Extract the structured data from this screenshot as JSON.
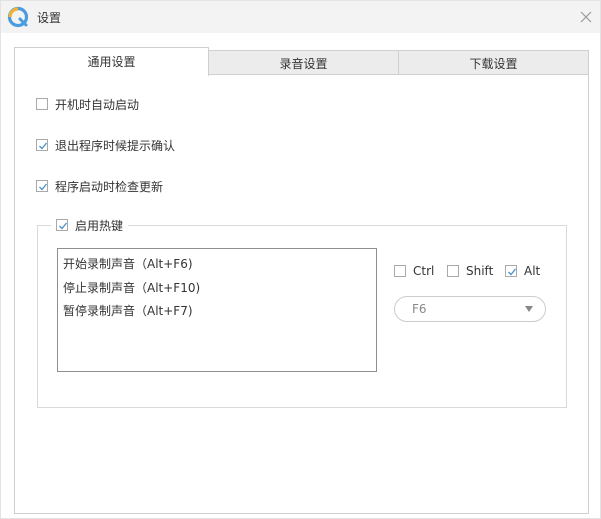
{
  "window": {
    "title": "设置"
  },
  "tabs": [
    {
      "label": "通用设置",
      "active": true
    },
    {
      "label": "录音设置",
      "active": false
    },
    {
      "label": "下载设置",
      "active": false
    }
  ],
  "general": {
    "auto_start": {
      "label": "开机时自动启动",
      "checked": false
    },
    "exit_confirm": {
      "label": "退出程序时候提示确认",
      "checked": true
    },
    "check_update": {
      "label": "程序启动时检查更新",
      "checked": true
    }
  },
  "hotkeys": {
    "enabled_label": "启用热键",
    "enabled": true,
    "items": [
      "开始录制声音（Alt+F6)",
      "停止录制声音（Alt+F10)",
      "暂停录制声音（Alt+F7)"
    ],
    "modifiers": [
      {
        "label": "Ctrl",
        "checked": false
      },
      {
        "label": "Shift",
        "checked": false
      },
      {
        "label": "Alt",
        "checked": true
      }
    ],
    "key_select": {
      "value": "F6"
    }
  },
  "colors": {
    "accent": "#5aa0d8",
    "check": "#4a90c8"
  }
}
